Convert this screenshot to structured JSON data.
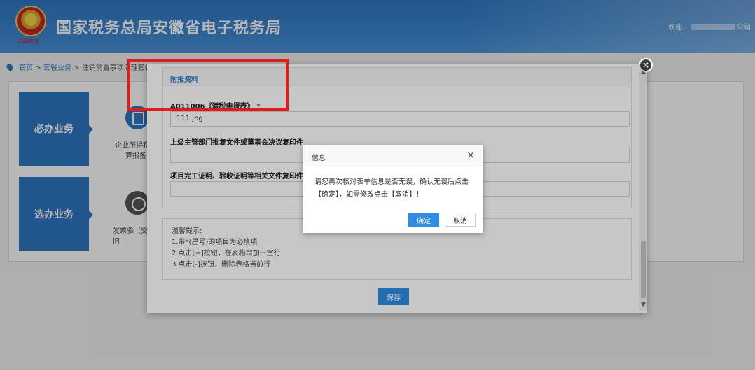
{
  "header": {
    "title": "国家税务总局安徽省电子税务局",
    "emblem_caption": "中国税务",
    "welcome": "欢迎，",
    "company_suffix": "公司"
  },
  "breadcrumb": {
    "home": "首页",
    "sep1": ">",
    "section": "套餐业务",
    "sep2": ">",
    "current": "注销前置事项清理套餐"
  },
  "background": {
    "required_label": "必办业务",
    "optional_label": "选办业务",
    "item1": "企业所得税清算报备",
    "item2": "发票验（交）旧"
  },
  "modal": {
    "attach_title": "附报资料",
    "field1_label": "A011006《清税申报表》",
    "field1_required": "*",
    "field1_value": "111.jpg",
    "field2_label": "上级主管部门批复文件或董事会决议复印件",
    "field3_label": "项目完工证明、验收证明等相关文件复印件",
    "tips": [
      "温馨提示:",
      "1.带*(星号)的项目为必填项",
      "2.点击[+]按钮，在表格增加一空行",
      "3.点击[-]按钮，删除表格当前行"
    ],
    "save_label": "保存"
  },
  "dialog": {
    "title": "信息",
    "close": "×",
    "message": "请您再次核对表单信息是否无误，确认无误后点击【确定】，如需修改点击【取消】！",
    "ok_label": "确定",
    "cancel_label": "取消"
  },
  "icons": {
    "modal_close": "×",
    "scroll_up": "▲",
    "scroll_down": "▼"
  },
  "colors": {
    "brand": "#2f78c4",
    "highlight": "#e11a1a",
    "required": "#e03a3a"
  }
}
